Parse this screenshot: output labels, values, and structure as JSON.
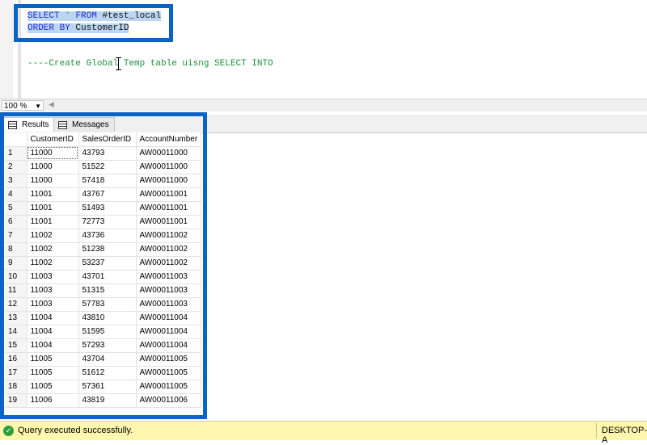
{
  "editor": {
    "line1": {
      "select": "SELECT",
      "star": "*",
      "from": "FROM",
      "table": "#test_local"
    },
    "line2": {
      "order_by": "ORDER BY",
      "column": "CustomerID"
    },
    "comment": "----Create Global Temp table uisng SELECT INTO"
  },
  "zoom": {
    "value": "100 %"
  },
  "tabs": {
    "results": "Results",
    "messages": "Messages"
  },
  "grid": {
    "columns": [
      "CustomerID",
      "SalesOrderID",
      "AccountNumber"
    ],
    "rows": [
      [
        "1",
        "11000",
        "43793",
        "AW00011000"
      ],
      [
        "2",
        "11000",
        "51522",
        "AW00011000"
      ],
      [
        "3",
        "11000",
        "57418",
        "AW00011000"
      ],
      [
        "4",
        "11001",
        "43767",
        "AW00011001"
      ],
      [
        "5",
        "11001",
        "51493",
        "AW00011001"
      ],
      [
        "6",
        "11001",
        "72773",
        "AW00011001"
      ],
      [
        "7",
        "11002",
        "43736",
        "AW00011002"
      ],
      [
        "8",
        "11002",
        "51238",
        "AW00011002"
      ],
      [
        "9",
        "11002",
        "53237",
        "AW00011002"
      ],
      [
        "10",
        "11003",
        "43701",
        "AW00011003"
      ],
      [
        "11",
        "11003",
        "51315",
        "AW00011003"
      ],
      [
        "12",
        "11003",
        "57783",
        "AW00011003"
      ],
      [
        "13",
        "11004",
        "43810",
        "AW00011004"
      ],
      [
        "14",
        "11004",
        "51595",
        "AW00011004"
      ],
      [
        "15",
        "11004",
        "57293",
        "AW00011004"
      ],
      [
        "16",
        "11005",
        "43704",
        "AW00011005"
      ],
      [
        "17",
        "11005",
        "51612",
        "AW00011005"
      ],
      [
        "18",
        "11005",
        "57361",
        "AW00011005"
      ],
      [
        "19",
        "11006",
        "43819",
        "AW00011006"
      ]
    ]
  },
  "status": {
    "message": "Query executed successfully.",
    "server": "DESKTOP-A",
    "ok_icon": "check-circle-icon"
  },
  "colors": {
    "highlight_border": "#0a63c6",
    "keyword": "#1c2bd6",
    "comment": "#1f8f3a",
    "status_bg": "#fff7ae"
  }
}
